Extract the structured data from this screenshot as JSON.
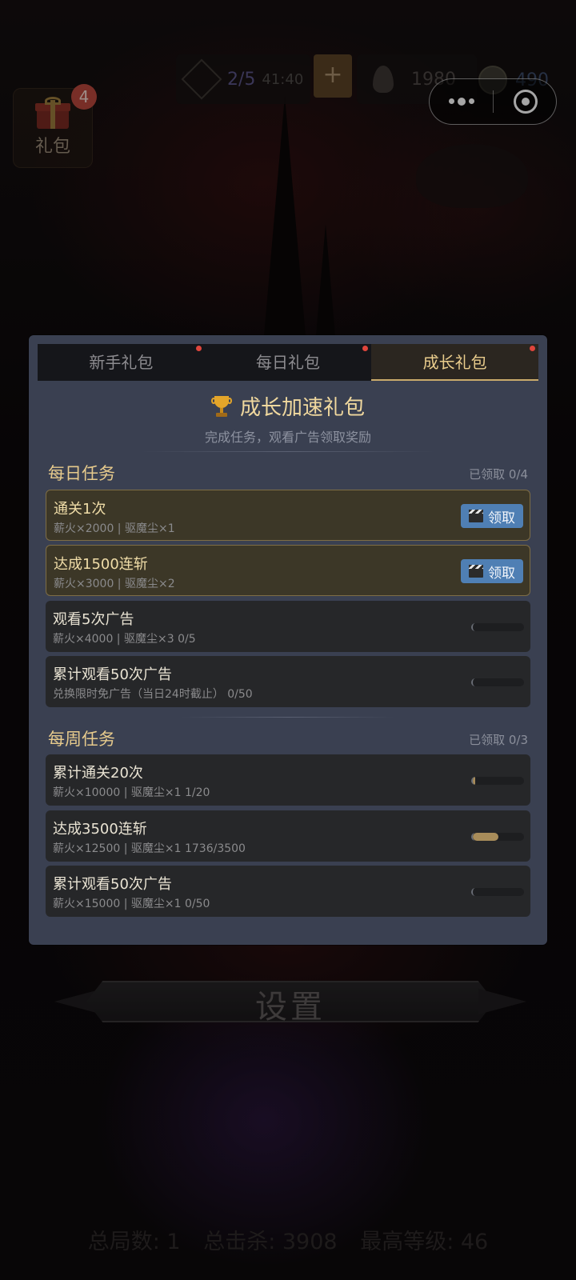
{
  "hud": {
    "gift_label": "礼包",
    "gift_badge": "4",
    "energy_count": "2/5",
    "energy_timer": "41:40",
    "add_label": "+",
    "fire_value": "1980",
    "dust_value": "490"
  },
  "tabs": [
    {
      "label": "新手礼包",
      "has_dot": true,
      "active": false
    },
    {
      "label": "每日礼包",
      "has_dot": true,
      "active": false
    },
    {
      "label": "成长礼包",
      "has_dot": true,
      "active": true
    }
  ],
  "panel": {
    "title": "成长加速礼包",
    "subtitle": "完成任务，观看广告领取奖励"
  },
  "daily": {
    "title": "每日任务",
    "count": "已领取 0/4",
    "tasks": [
      {
        "name": "通关1次",
        "reward": "薪火×2000 | 驱魔尘×1",
        "claim_label": "领取",
        "progress": null
      },
      {
        "name": "达成1500连斩",
        "reward": "薪火×3000 | 驱魔尘×2",
        "claim_label": "领取",
        "progress": null
      },
      {
        "name": "观看5次广告",
        "reward": "薪火×4000 | 驱魔尘×3  0/5",
        "claim_label": null,
        "progress": 0.0
      },
      {
        "name": "累计观看50次广告",
        "reward": "兑换限时免广告（当日24时截止）  0/50",
        "claim_label": null,
        "progress": 0.0
      }
    ]
  },
  "weekly": {
    "title": "每周任务",
    "count": "已领取 0/3",
    "tasks": [
      {
        "name": "累计通关20次",
        "reward": "薪火×10000 | 驱魔尘×1  1/20",
        "progress": 0.05
      },
      {
        "name": "达成3500连斩",
        "reward": "薪火×12500 | 驱魔尘×1  1736/3500",
        "progress": 0.496
      },
      {
        "name": "累计观看50次广告",
        "reward": "薪火×15000 | 驱魔尘×1  0/50",
        "progress": 0.0
      }
    ]
  },
  "settings_label": "设置",
  "stats": {
    "rounds": "总局数: 1",
    "kills": "总击杀: 3908",
    "max_level": "最高等级: 46"
  },
  "colors": {
    "panel_bg": "#3a4051",
    "accent_gold": "#e6ca8c",
    "claim_blue": "#4f7fb4",
    "badge_red": "#b8483c"
  }
}
